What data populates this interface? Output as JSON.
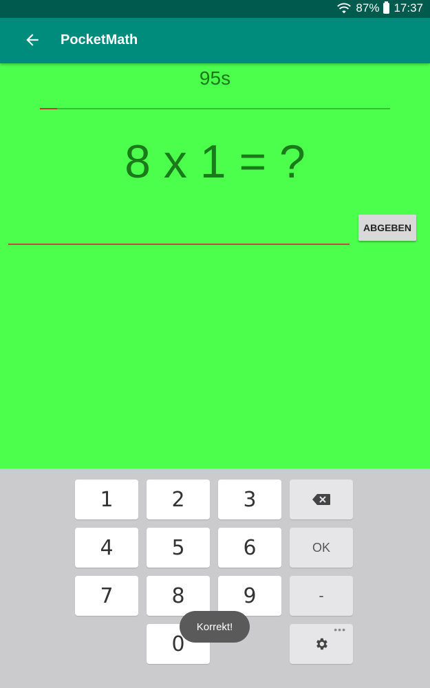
{
  "status": {
    "battery_text": "87%",
    "time": "17:37"
  },
  "app": {
    "title": "PocketMath"
  },
  "game": {
    "timer": "95s",
    "progress": 0.05,
    "question": "8 x 1 = ?",
    "answer_value": "",
    "submit_label": "ABGEBEN"
  },
  "keyboard": {
    "keys": {
      "k1": "1",
      "k2": "2",
      "k3": "3",
      "k4": "4",
      "k5": "5",
      "k6": "6",
      "k7": "7",
      "k8": "8",
      "k9": "9",
      "k0": "0",
      "ok": "OK",
      "minus": "-"
    },
    "icons": {
      "backspace": "backspace-icon",
      "settings": "gear-icon"
    }
  },
  "toast": {
    "text": "Korrekt!"
  },
  "colors": {
    "background": "#4dff4d",
    "appbar": "#008c7c",
    "statusbar": "#005a4d",
    "progress_fill": "#c0392b"
  }
}
